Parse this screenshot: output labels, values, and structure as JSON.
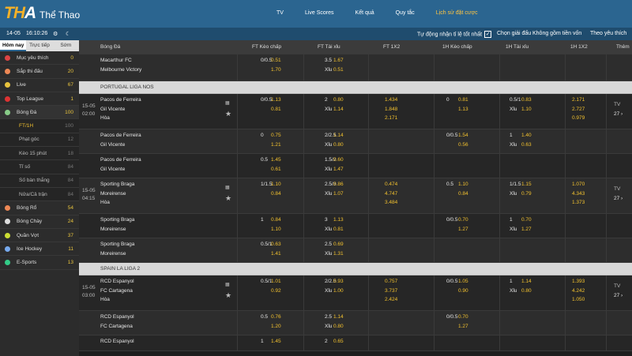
{
  "header": {
    "logo": "THA",
    "title": "Thể Thao",
    "nav": [
      "TV",
      "Live Scores",
      "Kết quả",
      "Quy tắc",
      "Lịch sử đặt cược"
    ]
  },
  "bar": {
    "date": "14-05",
    "time": "16:10:26",
    "auto_accept": "Tự động nhận tỉ lệ tốt nhất",
    "check": "✓",
    "choose_league": "Chọn giải đấu",
    "currency": "Không gồm tiền vốn",
    "sort": "Theo yêu thích"
  },
  "sidebar": {
    "tabs": [
      "Hôm nay",
      "Trực tiếp",
      "Sớm"
    ],
    "items": [
      {
        "label": "Mục yêu thích",
        "count": "0",
        "color": "#d44",
        "sub": false
      },
      {
        "label": "Sắp thi đấu",
        "count": "20",
        "color": "#e85",
        "sub": false
      },
      {
        "label": "Live",
        "count": "67",
        "color": "#e8c33d",
        "sub": false
      },
      {
        "label": "Top League",
        "count": "1",
        "color": "#d33",
        "sub": false
      },
      {
        "label": "Bóng Đá",
        "count": "100",
        "color": "#8c8",
        "sub": false
      },
      {
        "label": "FT/1H",
        "count": "100",
        "color": "",
        "sub": true
      },
      {
        "label": "Phạt góc",
        "count": "12",
        "color": "",
        "sub": true
      },
      {
        "label": "Kèo 15 phút",
        "count": "18",
        "color": "",
        "sub": true
      },
      {
        "label": "Tỉ số",
        "count": "84",
        "color": "",
        "sub": true
      },
      {
        "label": "Số bàn thắng",
        "count": "84",
        "color": "",
        "sub": true
      },
      {
        "label": "Nửa/Cả trận",
        "count": "84",
        "color": "",
        "sub": true
      },
      {
        "label": "Bóng Rổ",
        "count": "54",
        "color": "#e85",
        "sub": false
      },
      {
        "label": "Bóng Chày",
        "count": "24",
        "color": "#ddd",
        "sub": false
      },
      {
        "label": "Quần Vợt",
        "count": "37",
        "color": "#cd3",
        "sub": false
      },
      {
        "label": "Ice Hockey",
        "count": "11",
        "color": "#7ae",
        "sub": false
      },
      {
        "label": "E-Sports",
        "count": "13",
        "color": "#3c8",
        "sub": false
      }
    ]
  },
  "table": {
    "headers": [
      "Bóng Đá",
      "FT Kèo chấp",
      "FT Tài xỉu",
      "FT 1X2",
      "1H Kèo chấp",
      "1H Tài xỉu",
      "1H 1X2",
      "Thêm"
    ],
    "blocks": [
      {
        "type": "row",
        "h": 34,
        "odd": true,
        "lines": [
          {
            "t": "Macarthur FC",
            "h1": "0/0.5",
            "h2": "0.51",
            "o1": "3.5",
            "o2": "1.67"
          },
          {
            "t": "Melbourne Victory",
            "h2": "1.70",
            "o1": "Xỉu",
            "o2": "0.51"
          }
        ]
      },
      {
        "type": "league",
        "name": "PORTUGAL LIGA NOS"
      },
      {
        "type": "row",
        "h": 45,
        "date": "15-05",
        "time": "02:00",
        "extra": "TV",
        "more": "27 ›",
        "lines": [
          {
            "t": "Pacos de Ferreira",
            "h1": "0/0.5",
            "h2": "1.13",
            "o1": "2",
            "o2": "0.80",
            "x": "1.434",
            "hh1": "0",
            "hh2": "0.81",
            "ho1": "0.5/1",
            "ho2": "0.83",
            "hx": "2.171"
          },
          {
            "t": "Gil Vicente",
            "h2": "0.81",
            "o1": "Xỉu",
            "o2": "1.14",
            "x": "1.848",
            "hh2": "1.13",
            "ho1": "Xỉu",
            "ho2": "1.10",
            "hx": "2.727"
          },
          {
            "t": "Hòa",
            "x": "2.171",
            "hx": "0.979"
          }
        ]
      },
      {
        "type": "row",
        "h": 31,
        "odd": true,
        "lines": [
          {
            "t": "Pacos de Ferreira",
            "h1": "0",
            "h2": "0.75",
            "o1": "2/2.5",
            "o2": "1.14",
            "hh1": "0/0.5",
            "hh2": "1.54",
            "ho1": "1",
            "ho2": "1.40"
          },
          {
            "t": "Gil Vicente",
            "h2": "1.21",
            "o1": "Xỉu",
            "o2": "0.80",
            "hh2": "0.56",
            "ho1": "Xỉu",
            "ho2": "0.63"
          }
        ]
      },
      {
        "type": "row",
        "h": 31,
        "lines": [
          {
            "t": "Pacos de Ferreira",
            "h1": "0.5",
            "h2": "1.45",
            "o1": "1.5/2",
            "o2": "0.60"
          },
          {
            "t": "Gil Vicente",
            "h2": "0.61",
            "o1": "Xỉu",
            "o2": "1.47"
          }
        ]
      },
      {
        "type": "row",
        "h": 45,
        "odd": true,
        "date": "15-05",
        "time": "04:15",
        "extra": "TV",
        "more": "27 ›",
        "lines": [
          {
            "t": "Sporting Braga",
            "h1": "1/1.5",
            "h2": "1.10",
            "o1": "2.5/3",
            "o2": "0.86",
            "x": "0.474",
            "hh1": "0.5",
            "hh2": "1.10",
            "ho1": "1/1.5",
            "ho2": "1.15",
            "hx": "1.070"
          },
          {
            "t": "Moreirense",
            "h2": "0.84",
            "o1": "Xỉu",
            "o2": "1.07",
            "x": "4.747",
            "hh2": "0.84",
            "ho1": "Xỉu",
            "ho2": "0.79",
            "hx": "4.343"
          },
          {
            "t": "Hòa",
            "x": "3.484",
            "hx": "1.373"
          }
        ]
      },
      {
        "type": "row",
        "h": 31,
        "lines": [
          {
            "t": "Sporting Braga",
            "h1": "1",
            "h2": "0.84",
            "o1": "3",
            "o2": "1.13",
            "hh1": "0/0.5",
            "hh2": "0.70",
            "ho1": "1",
            "ho2": "0.70"
          },
          {
            "t": "Moreirense",
            "h2": "1.10",
            "o1": "Xỉu",
            "o2": "0.81",
            "hh2": "1.27",
            "ho1": "Xỉu",
            "ho2": "1.27"
          }
        ]
      },
      {
        "type": "row",
        "h": 31,
        "odd": true,
        "lines": [
          {
            "t": "Sporting Braga",
            "h1": "0.5/1",
            "h2": "0.63",
            "o1": "2.5",
            "o2": "0.69"
          },
          {
            "t": "Moreirense",
            "h2": "1.41",
            "o1": "Xỉu",
            "o2": "1.31"
          }
        ]
      },
      {
        "type": "league",
        "name": "SPAIN LA LIGA 2"
      },
      {
        "type": "row",
        "h": 45,
        "date": "15-05",
        "time": "03:00",
        "extra": "TV",
        "more": "27 ›",
        "lines": [
          {
            "t": "RCD Espanyol",
            "h1": "0.5/1",
            "h2": "1.01",
            "o1": "2/2.5",
            "o2": "0.93",
            "x": "0.757",
            "hh1": "0/0.5",
            "hh2": "1.05",
            "ho1": "1",
            "ho2": "1.14",
            "hx": "1.393"
          },
          {
            "t": "FC Cartagena",
            "h2": "0.92",
            "o1": "Xỉu",
            "o2": "1.00",
            "x": "3.737",
            "hh2": "0.90",
            "ho1": "Xỉu",
            "ho2": "0.80",
            "hx": "4.242"
          },
          {
            "t": "Hòa",
            "x": "2.424",
            "hx": "1.050"
          }
        ]
      },
      {
        "type": "row",
        "h": 31,
        "odd": true,
        "lines": [
          {
            "t": "RCD Espanyol",
            "h1": "0.5",
            "h2": "0.76",
            "o1": "2.5",
            "o2": "1.14",
            "hh1": "0/0.5",
            "hh2": "0.70"
          },
          {
            "t": "FC Cartagena",
            "h2": "1.20",
            "o1": "Xỉu",
            "o2": "0.80",
            "hh2": "1.27"
          }
        ]
      },
      {
        "type": "row",
        "h": 20,
        "lines": [
          {
            "t": "RCD Espanyol",
            "h1": "1",
            "h2": "1.45",
            "o1": "2",
            "o2": "0.65"
          }
        ]
      }
    ]
  }
}
